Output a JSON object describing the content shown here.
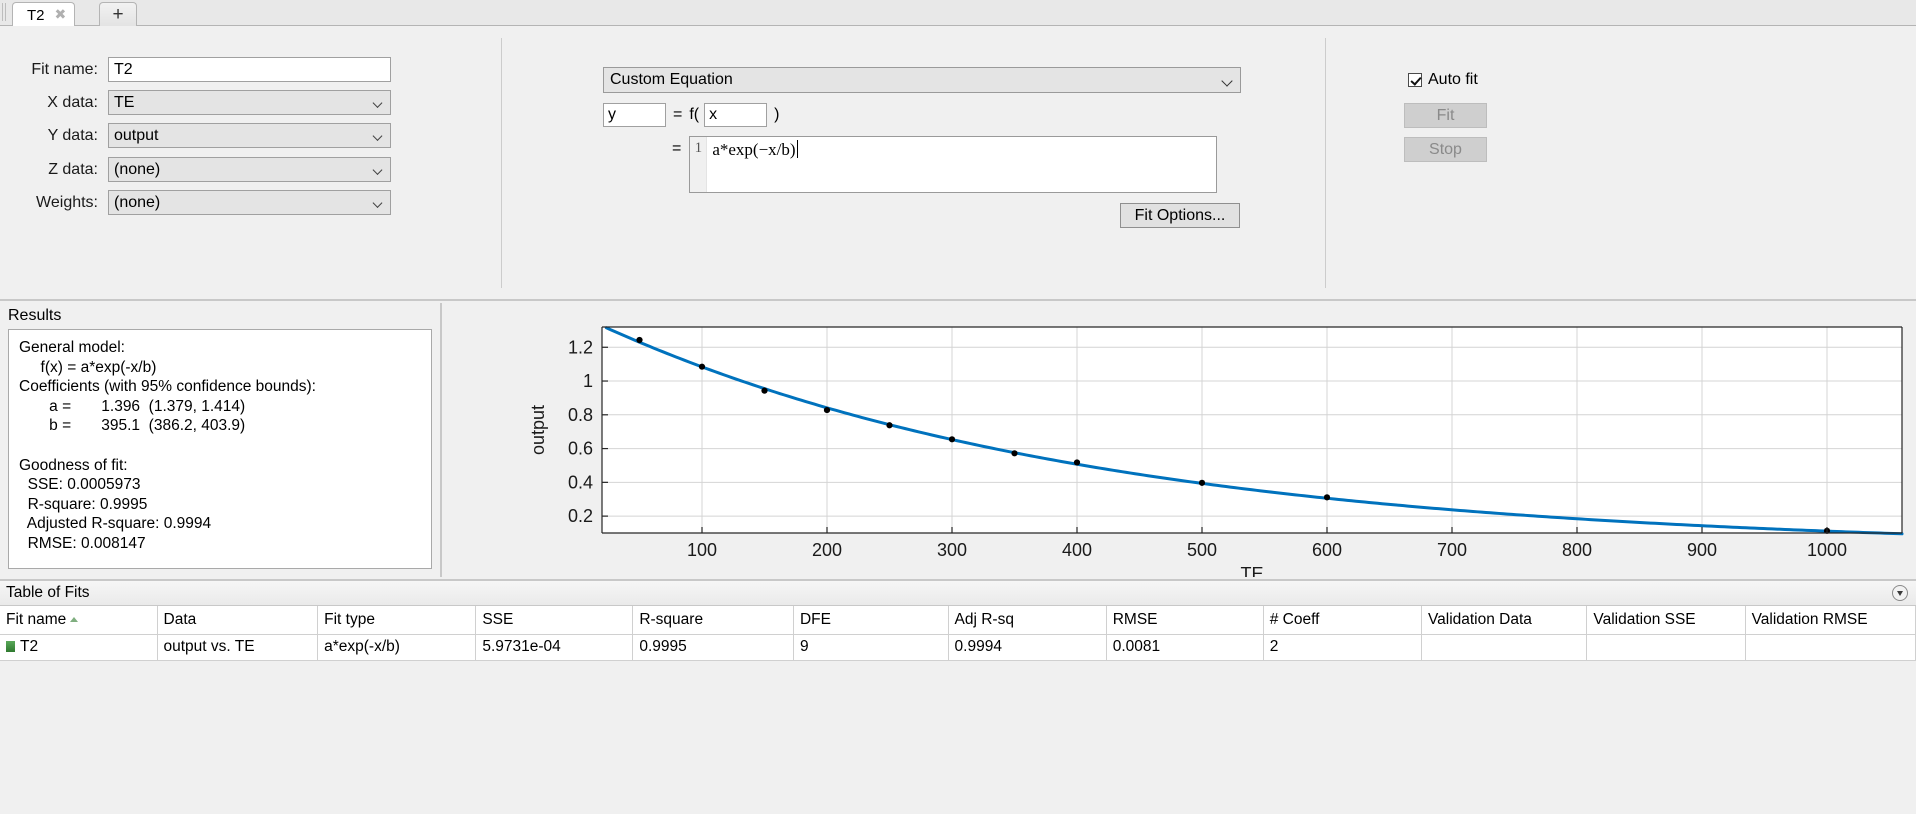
{
  "window": {
    "tabs": [
      {
        "label": "T2",
        "close_icon": "close-icon"
      }
    ],
    "add_tab_label": "+"
  },
  "fit_form": {
    "fit_name_label": "Fit name:",
    "fit_name_value": "T2",
    "x_data_label": "X data:",
    "x_data_value": "TE",
    "y_data_label": "Y data:",
    "y_data_value": "output",
    "z_data_label": "Z data:",
    "z_data_value": "(none)",
    "weights_label": "Weights:",
    "weights_value": "(none)"
  },
  "equation": {
    "model_type": "Custom Equation",
    "dependent_value": "y",
    "equals_label": "=",
    "f_label": "f(",
    "independent_value": "x",
    "close_paren": ")",
    "second_equals": "=",
    "line_number": "1",
    "expression": "a*exp(−x/b)",
    "fit_options_label": "Fit Options..."
  },
  "controls": {
    "auto_fit_label": "Auto fit",
    "auto_fit_checked": true,
    "fit_label": "Fit",
    "stop_label": "Stop"
  },
  "results": {
    "title": "Results",
    "text": "General model:\n     f(x) = a*exp(-x/b)\nCoefficients (with 95% confidence bounds):\n       a =       1.396  (1.379, 1.414)\n       b =       395.1  (386.2, 403.9)\n\nGoodness of fit:\n  SSE: 0.0005973\n  R-square: 0.9995\n  Adjusted R-square: 0.9994\n  RMSE: 0.008147"
  },
  "chart_data": {
    "type": "scatter",
    "title": "",
    "xlabel": "TE",
    "ylabel": "output",
    "xlim": [
      20,
      1060
    ],
    "ylim": [
      0.1,
      1.32
    ],
    "xticks": [
      100,
      200,
      300,
      400,
      500,
      600,
      700,
      800,
      900,
      1000
    ],
    "yticks": [
      0.2,
      0.4,
      0.6,
      0.8,
      1,
      1.2
    ],
    "ytick_labels": [
      "0.2",
      "0.4",
      "0.6",
      "0.8",
      "1",
      "1.2"
    ],
    "grid": true,
    "legend": "none",
    "series": [
      {
        "name": "T2",
        "kind": "scatter",
        "marker_color": "#000000",
        "x": [
          50,
          100,
          150,
          200,
          250,
          300,
          350,
          400,
          500,
          600,
          1000
        ],
        "y": [
          1.243,
          1.085,
          0.943,
          0.828,
          0.738,
          0.655,
          0.572,
          0.518,
          0.397,
          0.311,
          0.113
        ]
      },
      {
        "name": "a*exp(-x/b)",
        "kind": "line",
        "line_color": "#0072BD",
        "equation": "1.396*exp(-x/395.1)"
      }
    ]
  },
  "table_of_fits": {
    "title": "Table of Fits",
    "columns": [
      "Fit name",
      "Data",
      "Fit type",
      "SSE",
      "R-square",
      "DFE",
      "Adj R-sq",
      "RMSE",
      "# Coeff",
      "Validation Data",
      "Validation SSE",
      "Validation RMSE"
    ],
    "sorted_column": "Fit name",
    "rows": [
      {
        "fit_name": "T2",
        "data": "output vs. TE",
        "fit_type": "a*exp(-x/b)",
        "sse": "5.9731e-04",
        "r_square": "0.9995",
        "dfe": "9",
        "adj_r_sq": "0.9994",
        "rmse": "0.0081",
        "n_coeff": "2",
        "validation_data": "",
        "validation_sse": "",
        "validation_rmse": ""
      }
    ]
  },
  "colors": {
    "fit_line": "#0072BD",
    "panel_bg": "#f0f0f0",
    "marker": "#000000"
  }
}
